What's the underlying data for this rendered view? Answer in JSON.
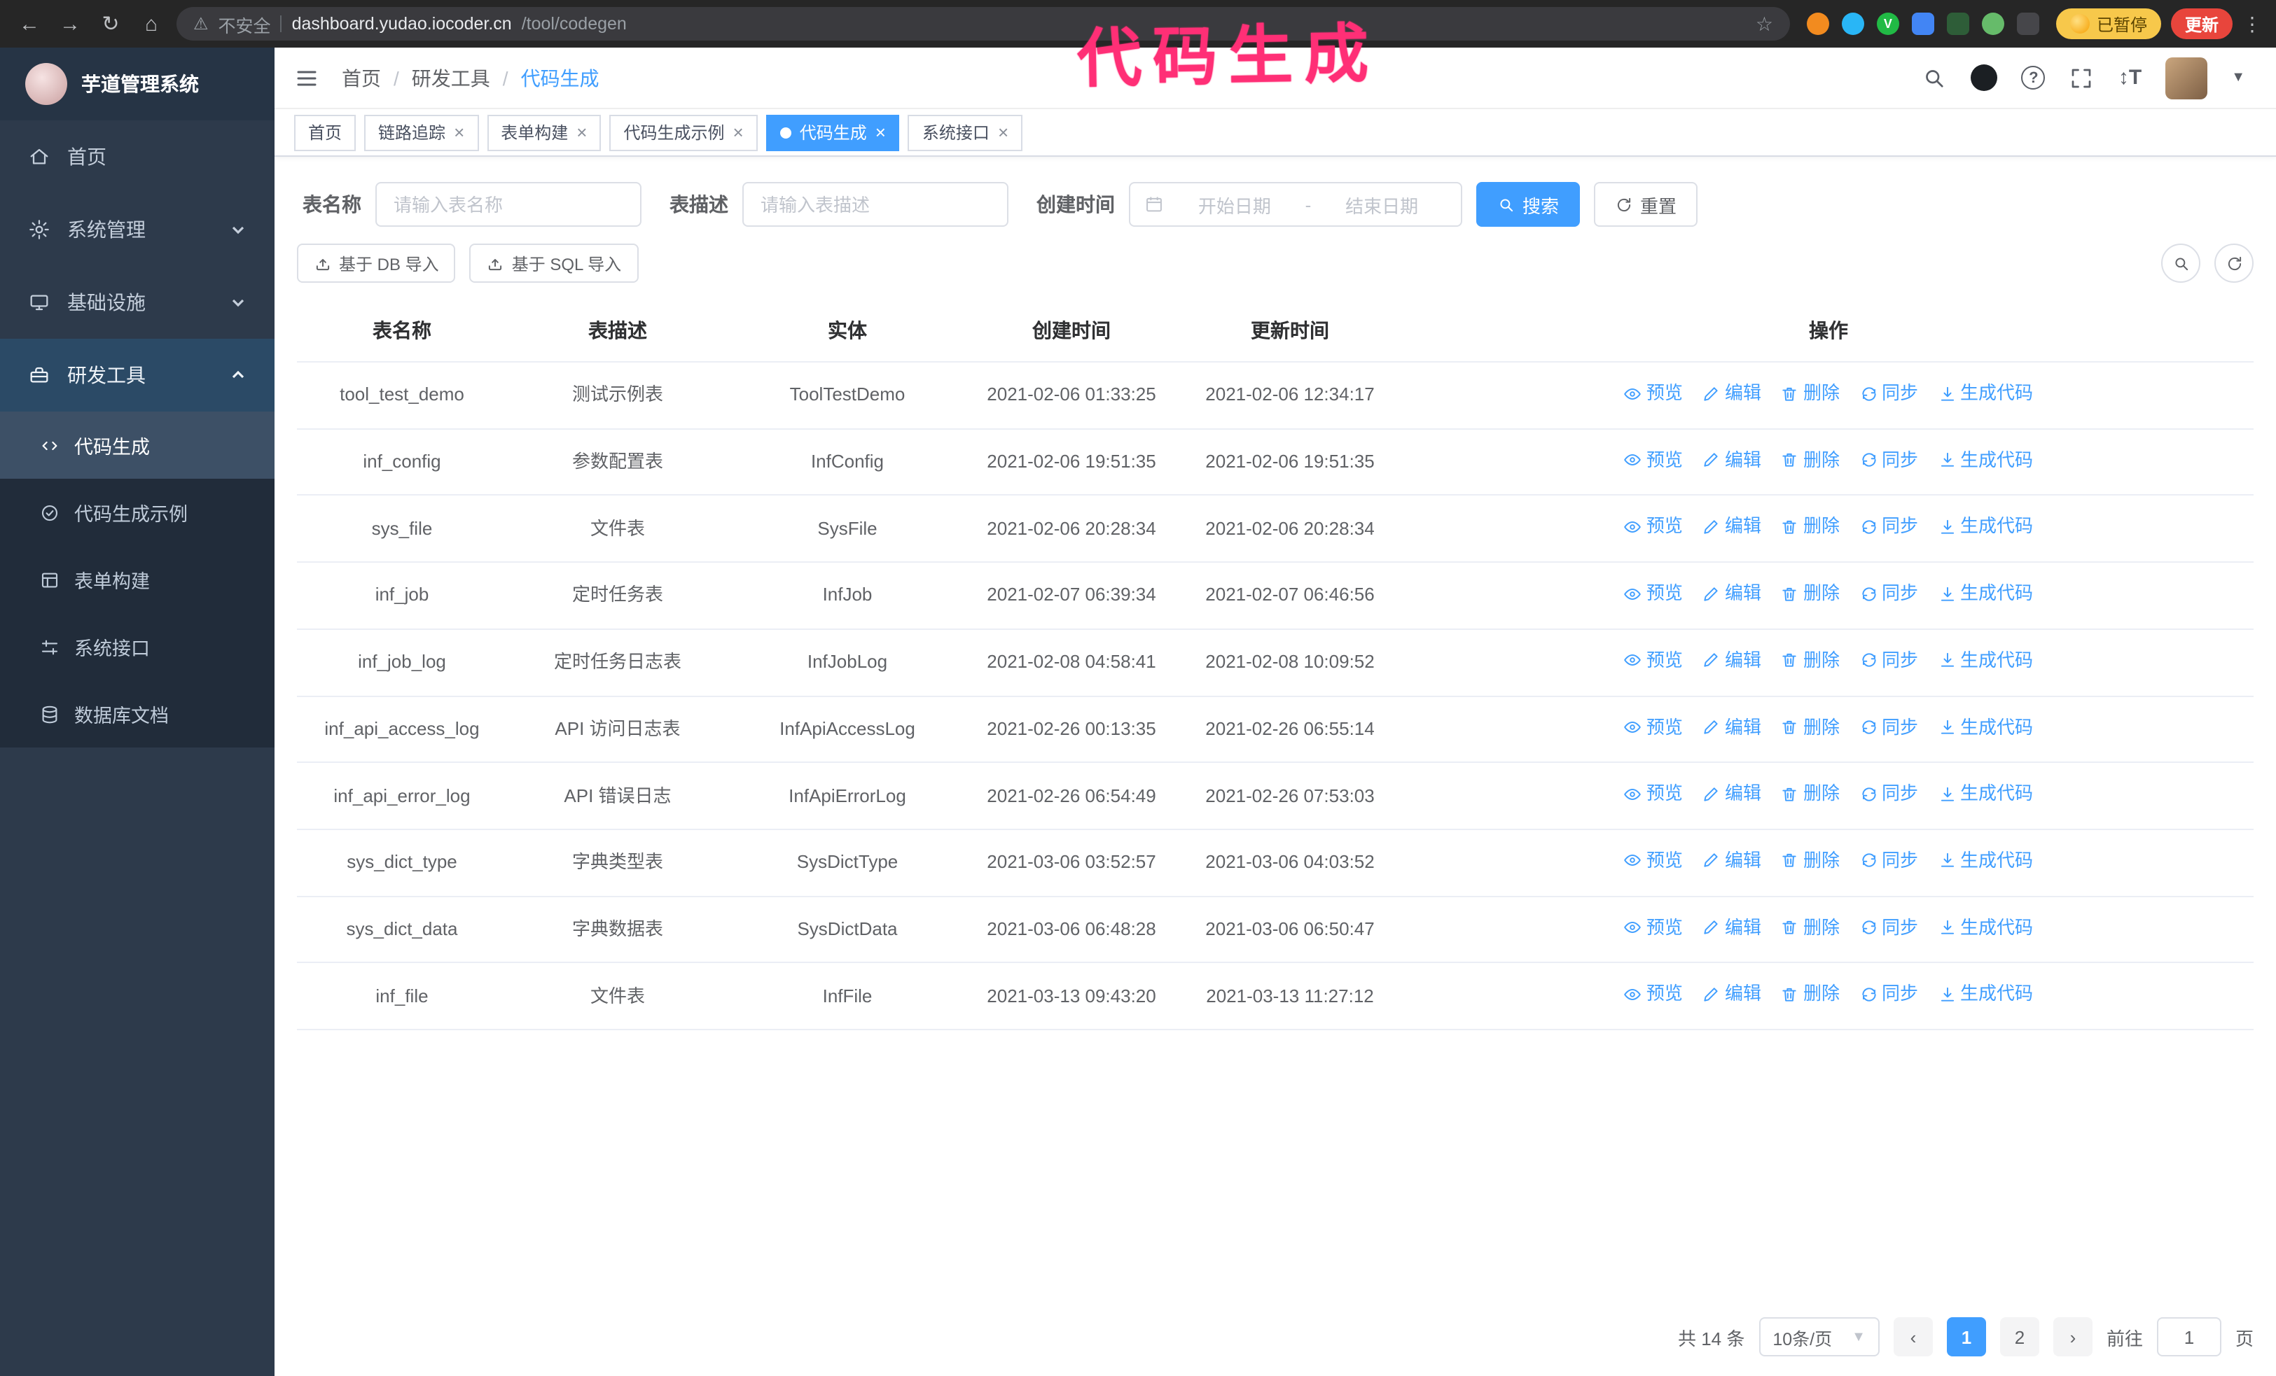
{
  "browser": {
    "security_warning": "不安全",
    "url_host": "dashboard.yudao.iocoder.cn",
    "url_path": "/tool/codegen",
    "paused_badge": "已暂停",
    "update_button": "更新"
  },
  "annotation": "代码生成",
  "sidebar": {
    "logo_title": "芋道管理系统",
    "items": [
      {
        "label": "首页"
      },
      {
        "label": "系统管理"
      },
      {
        "label": "基础设施"
      },
      {
        "label": "研发工具"
      }
    ],
    "subitems": [
      {
        "label": "代码生成"
      },
      {
        "label": "代码生成示例"
      },
      {
        "label": "表单构建"
      },
      {
        "label": "系统接口"
      },
      {
        "label": "数据库文档"
      }
    ]
  },
  "breadcrumb": {
    "items": [
      "首页",
      "研发工具",
      "代码生成"
    ],
    "separator": "/"
  },
  "tabs": [
    {
      "label": "首页"
    },
    {
      "label": "链路追踪"
    },
    {
      "label": "表单构建"
    },
    {
      "label": "代码生成示例"
    },
    {
      "label": "代码生成"
    },
    {
      "label": "系统接口"
    }
  ],
  "filters": {
    "table_name_label": "表名称",
    "table_name_placeholder": "请输入表名称",
    "table_desc_label": "表描述",
    "table_desc_placeholder": "请输入表描述",
    "create_time_label": "创建时间",
    "date_start_placeholder": "开始日期",
    "date_separator": "-",
    "date_end_placeholder": "结束日期",
    "search_button": "搜索",
    "reset_button": "重置"
  },
  "toolbar": {
    "import_db": "基于 DB 导入",
    "import_sql": "基于 SQL 导入"
  },
  "table": {
    "columns": [
      "表名称",
      "表描述",
      "实体",
      "创建时间",
      "更新时间",
      "操作"
    ],
    "actions": [
      {
        "label": "预览",
        "icon": "eye"
      },
      {
        "label": "编辑",
        "icon": "pencil"
      },
      {
        "label": "删除",
        "icon": "trash"
      },
      {
        "label": "同步",
        "icon": "sync"
      },
      {
        "label": "生成代码",
        "icon": "download"
      }
    ],
    "rows": [
      {
        "name": "tool_test_demo",
        "desc": "测试示例表",
        "entity": "ToolTestDemo",
        "created": "2021-02-06 01:33:25",
        "updated": "2021-02-06 12:34:17"
      },
      {
        "name": "inf_config",
        "desc": "参数配置表",
        "entity": "InfConfig",
        "created": "2021-02-06 19:51:35",
        "updated": "2021-02-06 19:51:35"
      },
      {
        "name": "sys_file",
        "desc": "文件表",
        "entity": "SysFile",
        "created": "2021-02-06 20:28:34",
        "updated": "2021-02-06 20:28:34"
      },
      {
        "name": "inf_job",
        "desc": "定时任务表",
        "entity": "InfJob",
        "created": "2021-02-07 06:39:34",
        "updated": "2021-02-07 06:46:56"
      },
      {
        "name": "inf_job_log",
        "desc": "定时任务日志表",
        "entity": "InfJobLog",
        "created": "2021-02-08 04:58:41",
        "updated": "2021-02-08 10:09:52"
      },
      {
        "name": "inf_api_access_log",
        "desc": "API 访问日志表",
        "entity": "InfApiAccessLog",
        "created": "2021-02-26 00:13:35",
        "updated": "2021-02-26 06:55:14"
      },
      {
        "name": "inf_api_error_log",
        "desc": "API 错误日志",
        "entity": "InfApiErrorLog",
        "created": "2021-02-26 06:54:49",
        "updated": "2021-02-26 07:53:03"
      },
      {
        "name": "sys_dict_type",
        "desc": "字典类型表",
        "entity": "SysDictType",
        "created": "2021-03-06 03:52:57",
        "updated": "2021-03-06 04:03:52"
      },
      {
        "name": "sys_dict_data",
        "desc": "字典数据表",
        "entity": "SysDictData",
        "created": "2021-03-06 06:48:28",
        "updated": "2021-03-06 06:50:47"
      },
      {
        "name": "inf_file",
        "desc": "文件表",
        "entity": "InfFile",
        "created": "2021-03-13 09:43:20",
        "updated": "2021-03-13 11:27:12"
      }
    ]
  },
  "pagination": {
    "total": "共 14 条",
    "page_size": "10条/页",
    "pages": [
      "1",
      "2"
    ],
    "active_page": "1",
    "goto_label": "前往",
    "goto_value": "1",
    "goto_suffix": "页"
  },
  "colors": {
    "accent": "#409eff",
    "annotation_pink": "#ff2f76",
    "sidebar_bg": "#2d3a4b",
    "update_red": "#e8453c",
    "paused_yellow": "#f7c84b"
  }
}
